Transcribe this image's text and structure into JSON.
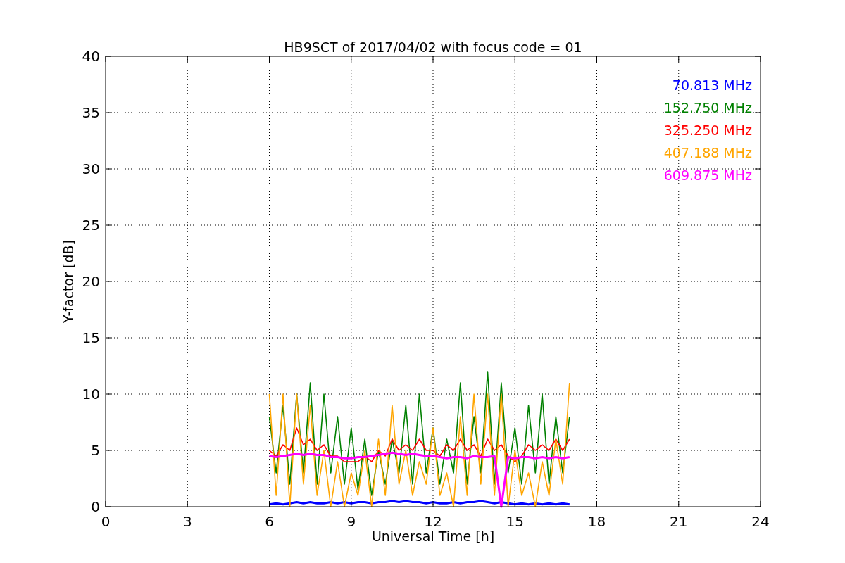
{
  "figure": {
    "chart_data": {
      "type": "line",
      "title": "HB9SCT of 2017/04/02 with focus code = 01",
      "xlabel": "Universal Time [h]",
      "ylabel": "Y-factor [dB]",
      "x": [
        6,
        6.25,
        6.5,
        6.75,
        7,
        7.25,
        7.5,
        7.75,
        8,
        8.25,
        8.5,
        8.75,
        9,
        9.25,
        9.5,
        9.75,
        10,
        10.25,
        10.5,
        10.75,
        11,
        11.25,
        11.5,
        11.75,
        12,
        12.25,
        12.5,
        12.75,
        13,
        13.25,
        13.5,
        13.75,
        14,
        14.25,
        14.5,
        14.75,
        15,
        15.25,
        15.5,
        15.75,
        16,
        16.25,
        16.5,
        16.75,
        17
      ],
      "grid": true,
      "xlim": [
        0,
        24
      ],
      "ylim": [
        0,
        40
      ],
      "xticks": [
        0,
        3,
        6,
        9,
        12,
        15,
        18,
        21,
        24
      ],
      "yticks": [
        0,
        5,
        10,
        15,
        20,
        25,
        30,
        35,
        40
      ],
      "series": [
        {
          "name": "70.813 MHz",
          "color": "#0000ff",
          "values": [
            0.2,
            0.3,
            0.2,
            0.3,
            0.4,
            0.3,
            0.4,
            0.3,
            0.3,
            0.4,
            0.3,
            0.4,
            0.3,
            0.4,
            0.4,
            0.3,
            0.4,
            0.4,
            0.5,
            0.4,
            0.5,
            0.4,
            0.4,
            0.3,
            0.4,
            0.3,
            0.3,
            0.4,
            0.3,
            0.4,
            0.4,
            0.5,
            0.4,
            0.3,
            0.4,
            0.3,
            0.2,
            0.3,
            0.2,
            0.3,
            0.2,
            0.3,
            0.2,
            0.3,
            0.2
          ]
        },
        {
          "name": "152.750 MHz",
          "color": "#008000",
          "values": [
            8,
            3,
            9,
            2,
            10,
            3,
            11,
            2,
            10,
            3,
            8,
            2,
            7,
            1.5,
            6,
            1,
            5,
            2,
            6,
            3,
            9,
            2,
            10,
            3,
            7,
            2,
            6,
            3,
            11,
            2,
            8,
            3,
            12,
            2,
            11,
            3,
            7,
            2,
            9,
            3,
            10,
            2,
            8,
            3,
            8
          ]
        },
        {
          "name": "325.250 MHz",
          "color": "#ff0000",
          "values": [
            5,
            4.5,
            5.5,
            5,
            7,
            5.5,
            6,
            5,
            5.5,
            4.5,
            4.5,
            4,
            4,
            4,
            4.5,
            4,
            5,
            4.5,
            6,
            5,
            5.5,
            5,
            6,
            5,
            5,
            4.5,
            5.5,
            5,
            6,
            5,
            5.5,
            4.5,
            6,
            5,
            5.5,
            4.5,
            4,
            4.5,
            5.5,
            5,
            5.5,
            5,
            6,
            5,
            6
          ]
        },
        {
          "name": "407.188 MHz",
          "color": "#ffa500",
          "values": [
            10,
            1,
            10,
            0,
            10,
            2,
            9,
            1,
            5,
            0,
            4,
            0,
            3,
            1,
            5,
            0,
            6,
            1,
            9,
            2,
            5,
            1,
            4,
            2,
            7,
            1,
            3,
            0,
            8,
            1,
            10,
            2,
            10,
            1,
            10,
            0,
            5,
            1,
            3,
            0,
            4,
            1,
            6,
            2,
            11
          ]
        },
        {
          "name": "609.875 MHz",
          "color": "#ff00ff",
          "values": [
            4.5,
            4.4,
            4.5,
            4.6,
            4.7,
            4.6,
            4.7,
            4.6,
            4.6,
            4.4,
            4.4,
            4.3,
            4.3,
            4.4,
            4.4,
            4.5,
            4.6,
            4.7,
            4.8,
            4.7,
            4.6,
            4.7,
            4.6,
            4.5,
            4.5,
            4.4,
            4.3,
            4.4,
            4.4,
            4.3,
            4.5,
            4.4,
            4.4,
            4.5,
            0,
            4.4,
            4.3,
            4.4,
            4.4,
            4.3,
            4.4,
            4.3,
            4.4,
            4.3,
            4.4
          ]
        }
      ]
    }
  }
}
